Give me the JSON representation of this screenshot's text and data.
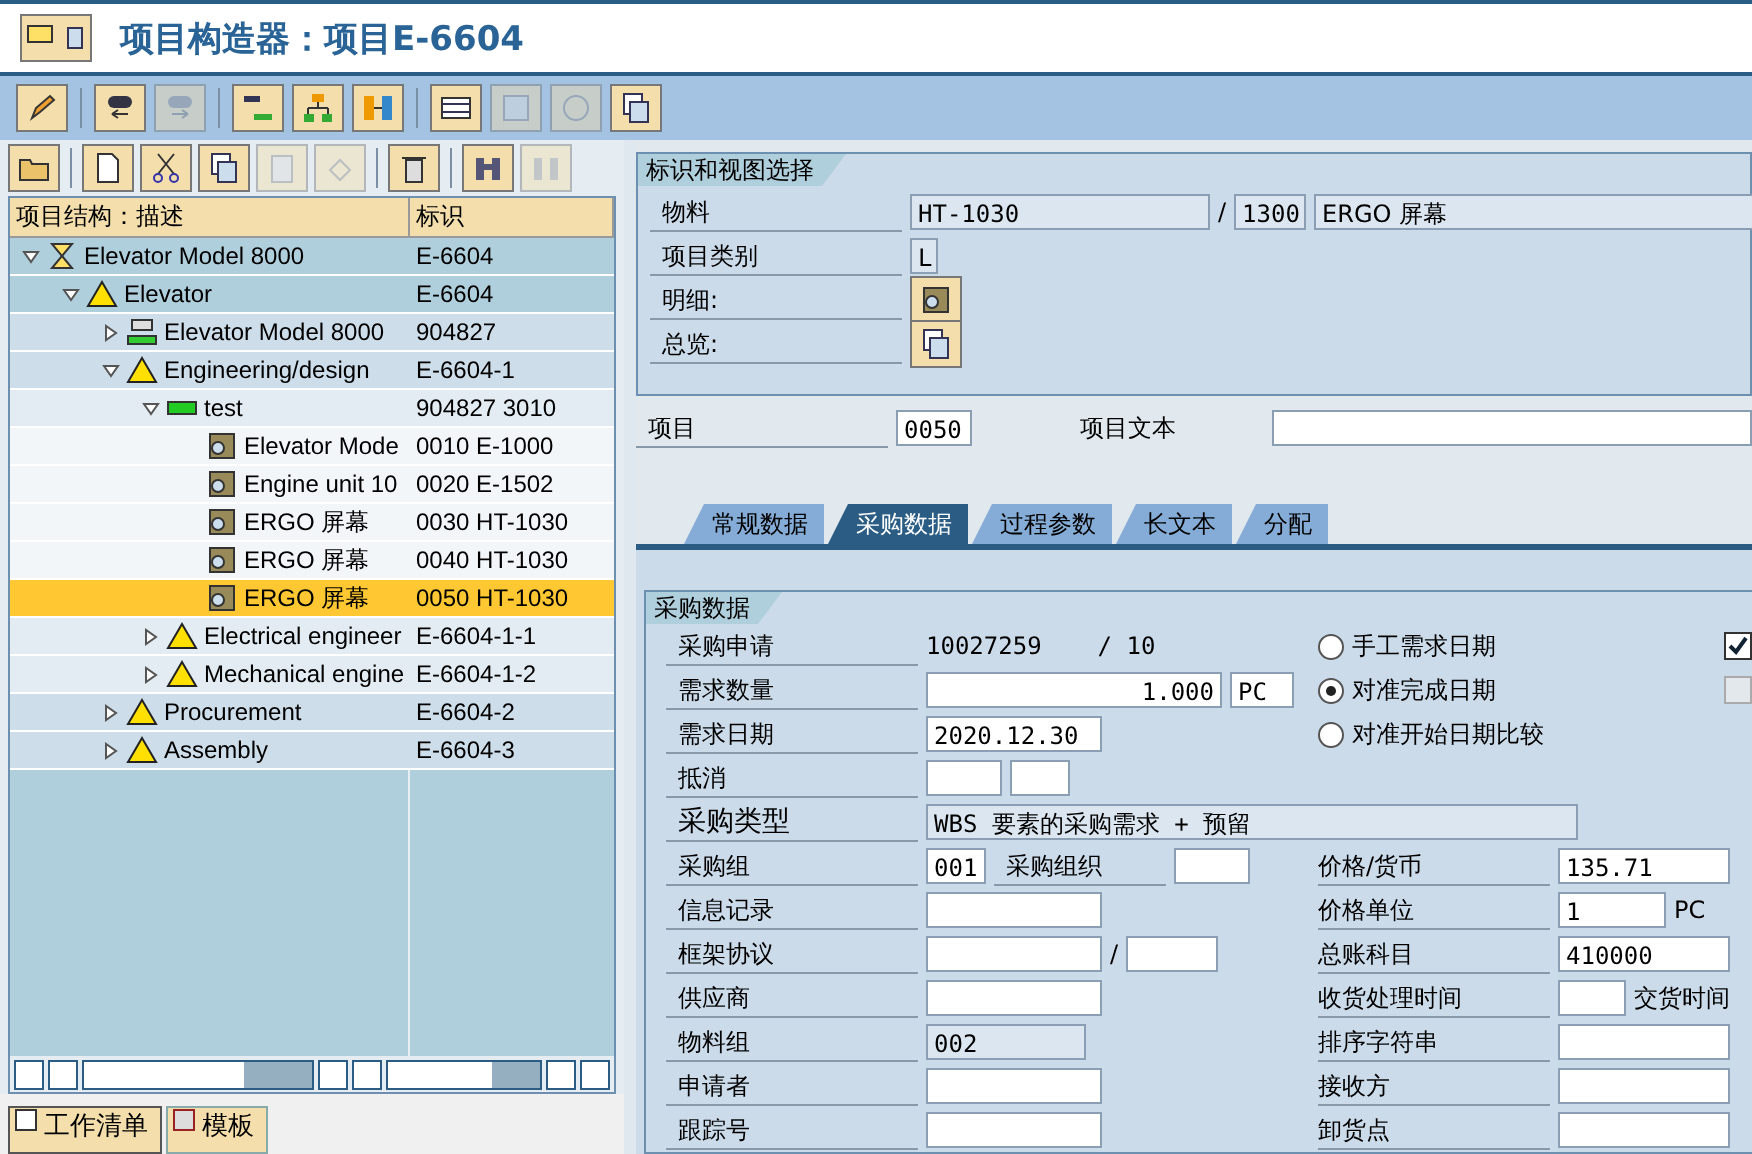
{
  "window": {
    "title": "项目构造器：项目E-6604"
  },
  "app_toolbar": [
    {
      "kind": "edit",
      "disabled": false
    },
    {
      "kind": "back",
      "disabled": false
    },
    {
      "kind": "forward",
      "disabled": true
    },
    {
      "kind": "gantt",
      "disabled": false
    },
    {
      "kind": "hierarchy",
      "disabled": false
    },
    {
      "kind": "network",
      "disabled": false
    },
    {
      "kind": "table",
      "disabled": false
    },
    {
      "kind": "form",
      "disabled": true
    },
    {
      "kind": "circle",
      "disabled": true
    },
    {
      "kind": "copy",
      "disabled": false
    }
  ],
  "tree_toolbar": [
    {
      "kind": "open",
      "disabled": false
    },
    {
      "kind": "new",
      "disabled": false
    },
    {
      "kind": "cut",
      "disabled": false
    },
    {
      "kind": "copy",
      "disabled": false
    },
    {
      "kind": "paste",
      "disabled": true
    },
    {
      "kind": "undo",
      "disabled": true
    },
    {
      "kind": "delete",
      "disabled": false
    },
    {
      "kind": "find",
      "disabled": false
    },
    {
      "kind": "find-next",
      "disabled": true
    }
  ],
  "tree": {
    "columns": [
      "项目结构：描述",
      "标识"
    ],
    "nodes": [
      {
        "label": "Elevator Model 8000",
        "id": "E-6604",
        "kind": "project",
        "expanded": true,
        "selected": false,
        "children": [
          {
            "label": "Elevator",
            "id": "E-6604",
            "kind": "warning",
            "expanded": true,
            "selected": false,
            "children": [
              {
                "label": "Elevator Model 8000",
                "id": "904827",
                "kind": "network",
                "expanded": false,
                "selected": false
              },
              {
                "label": "Engineering/design",
                "id": "E-6604-1",
                "kind": "warning",
                "expanded": true,
                "selected": false,
                "children": [
                  {
                    "label": "test",
                    "id": "904827 3010",
                    "kind": "activity",
                    "expanded": true,
                    "selected": false,
                    "children": [
                      {
                        "label": "Elevator Mode",
                        "id": "0010 E-1000",
                        "kind": "component",
                        "selected": false
                      },
                      {
                        "label": "Engine unit 10",
                        "id": "0020 E-1502",
                        "kind": "component",
                        "selected": false
                      },
                      {
                        "label": "ERGO 屏幕",
                        "id": "0030 HT-1030",
                        "kind": "component",
                        "selected": false
                      },
                      {
                        "label": "ERGO 屏幕",
                        "id": "0040 HT-1030",
                        "kind": "component",
                        "selected": false
                      },
                      {
                        "label": "ERGO 屏幕",
                        "id": "0050 HT-1030",
                        "kind": "component",
                        "selected": true
                      }
                    ]
                  },
                  {
                    "label": "Electrical engineer",
                    "id": "E-6604-1-1",
                    "kind": "warning",
                    "expanded": false,
                    "selected": false
                  },
                  {
                    "label": "Mechanical engine",
                    "id": "E-6604-1-2",
                    "kind": "warning",
                    "expanded": false,
                    "selected": false
                  }
                ]
              },
              {
                "label": "Procurement",
                "id": "E-6604-2",
                "kind": "warning",
                "expanded": false,
                "selected": false
              },
              {
                "label": "Assembly",
                "id": "E-6604-3",
                "kind": "warning",
                "expanded": false,
                "selected": false
              }
            ]
          }
        ]
      }
    ]
  },
  "bottom_tabs": [
    {
      "label": "工作清单",
      "selected": true
    },
    {
      "label": "模板",
      "selected": false
    }
  ],
  "header_section": {
    "title": "标识和视图选择",
    "material": {
      "label": "物料",
      "value": "HT-1030",
      "separator": "/",
      "plant": "1300",
      "description": "ERGO 屏幕"
    },
    "item_category": {
      "label": "项目类别",
      "value": "L"
    },
    "detail_label": "明细:",
    "overview_label": "总览:"
  },
  "item": {
    "label": "项目",
    "value": "0050",
    "text_label": "项目文本"
  },
  "tabs": [
    {
      "label": "常规数据",
      "selected": false
    },
    {
      "label": "采购数据",
      "selected": true
    },
    {
      "label": "过程参数",
      "selected": false
    },
    {
      "label": "长文本",
      "selected": false
    },
    {
      "label": "分配",
      "selected": false
    }
  ],
  "purchasing": {
    "title": "采购数据",
    "left": [
      {
        "label": "采购申请",
        "kind": "display",
        "value": "10027259",
        "extra": "/ 10"
      },
      {
        "label": "需求数量",
        "kind": "qty",
        "value": "1.000",
        "unit": "PC"
      },
      {
        "label": "需求日期",
        "kind": "field",
        "value": "2020.12.30"
      },
      {
        "label": "抵消",
        "kind": "pair"
      },
      {
        "label": "采购类型",
        "kind": "wide",
        "value": "WBS 要素的采购需求 + 预留"
      },
      {
        "label": "采购组",
        "kind": "org",
        "value": "001",
        "sublabel": "采购组织"
      },
      {
        "label": "信息记录",
        "kind": "field"
      },
      {
        "label": "框架协议",
        "kind": "slash",
        "separator": "/"
      },
      {
        "label": "供应商",
        "kind": "field"
      },
      {
        "label": "物料组",
        "kind": "readonly",
        "value": "002"
      },
      {
        "label": "申请者",
        "kind": "field"
      },
      {
        "label": "跟踪号",
        "kind": "field"
      }
    ],
    "radios": [
      {
        "label": "手工需求日期",
        "selected": false
      },
      {
        "label": "对准完成日期",
        "selected": true
      },
      {
        "label": "对准开始日期比较",
        "selected": false
      }
    ],
    "checkboxes": [
      {
        "checked": true,
        "disabled": false
      },
      {
        "checked": false,
        "disabled": true
      }
    ],
    "right": [
      {
        "label": "价格/货币",
        "value": "135.71"
      },
      {
        "label": "价格单位",
        "value": "1",
        "unit": "PC"
      },
      {
        "label": "总账科目",
        "value": "410000"
      },
      {
        "label": "收货处理时间",
        "unit": "交货时间"
      },
      {
        "label": "排序字符串"
      },
      {
        "label": "接收方"
      },
      {
        "label": "卸货点"
      }
    ]
  }
}
